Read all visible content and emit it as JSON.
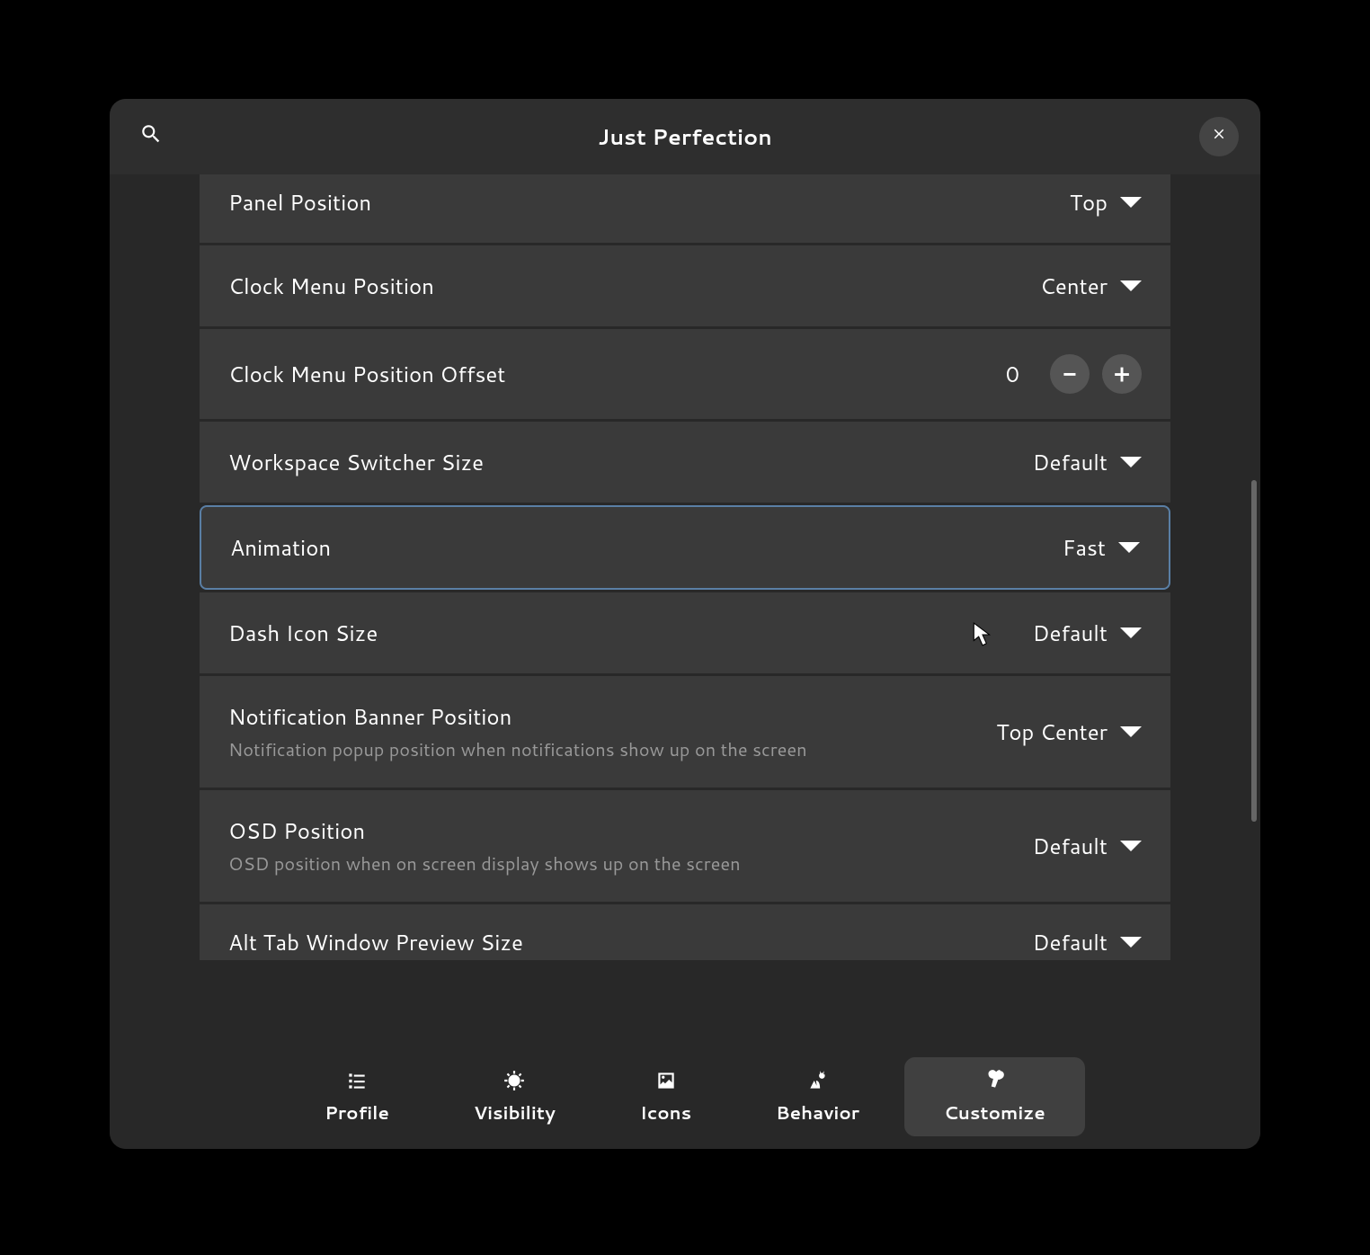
{
  "header": {
    "title": "Just Perfection"
  },
  "settings": [
    {
      "label": "Panel Position",
      "value": "Top",
      "type": "dropdown"
    },
    {
      "label": "Clock Menu Position",
      "value": "Center",
      "type": "dropdown"
    },
    {
      "label": "Clock Menu Position Offset",
      "value": "0",
      "type": "stepper"
    },
    {
      "label": "Workspace Switcher Size",
      "value": "Default",
      "type": "dropdown"
    },
    {
      "label": "Animation",
      "value": "Fast",
      "type": "dropdown"
    },
    {
      "label": "Dash Icon Size",
      "value": "Default",
      "type": "dropdown"
    },
    {
      "label": "Notification Banner Position",
      "subtitle": "Notification popup position when notifications show up on the screen",
      "value": "Top Center",
      "type": "dropdown"
    },
    {
      "label": "OSD Position",
      "subtitle": "OSD position when on screen display shows up on the screen",
      "value": "Default",
      "type": "dropdown"
    },
    {
      "label": "Alt Tab Window Preview Size",
      "value": "Default",
      "type": "dropdown"
    }
  ],
  "tabs": [
    {
      "label": "Profile",
      "icon": "list"
    },
    {
      "label": "Visibility",
      "icon": "sun"
    },
    {
      "label": "Icons",
      "icon": "image"
    },
    {
      "label": "Behavior",
      "icon": "gear-person"
    },
    {
      "label": "Customize",
      "icon": "paint"
    }
  ]
}
